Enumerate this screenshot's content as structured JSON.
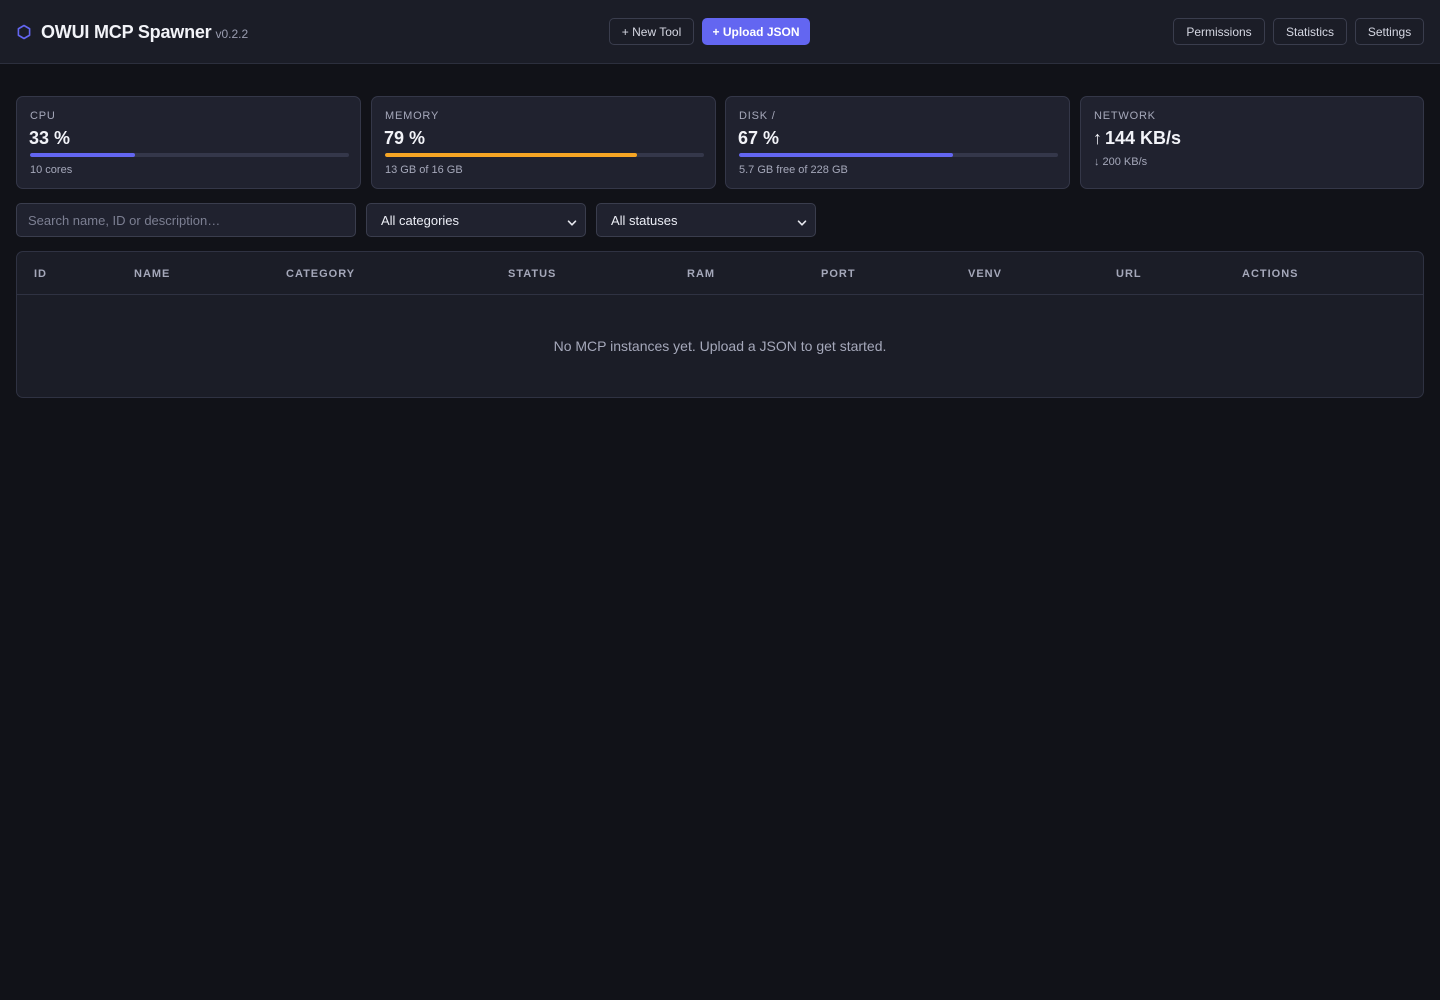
{
  "app": {
    "title": "OWUI MCP Spawner",
    "version": "v0.2.2",
    "brand_icon": "hexagon-icon",
    "accent_color": "#6366f1"
  },
  "toolbar": {
    "new_tool_label": "+ New Tool",
    "upload_json_label": "+ Upload JSON",
    "permissions_label": "Permissions",
    "statistics_label": "Statistics",
    "settings_label": "Settings"
  },
  "stats": {
    "cpu": {
      "label": "CPU",
      "value": "33 %",
      "percent": 33,
      "sub": "10 cores",
      "bar_color": "#6366f1"
    },
    "memory": {
      "label": "MEMORY",
      "value": "79 %",
      "percent": 79,
      "sub": "13 GB of 16 GB",
      "bar_color": "#f5a524"
    },
    "disk": {
      "label": "DISK /",
      "value": "67 %",
      "percent": 67,
      "sub": "5.7 GB free of 228 GB",
      "bar_color": "#6366f1"
    },
    "network": {
      "label": "NETWORK",
      "up_arrow": "↑",
      "up": "144 KB/s",
      "down_arrow": "↓",
      "down": "200 KB/s"
    }
  },
  "filters": {
    "search_placeholder": "Search name, ID or description…",
    "category_selected": "All categories",
    "status_selected": "All statuses"
  },
  "table": {
    "columns": [
      "ID",
      "NAME",
      "CATEGORY",
      "STATUS",
      "RAM",
      "PORT",
      "VENV",
      "URL",
      "ACTIONS"
    ],
    "empty_message": "No MCP instances yet. Upload a JSON to get started."
  }
}
